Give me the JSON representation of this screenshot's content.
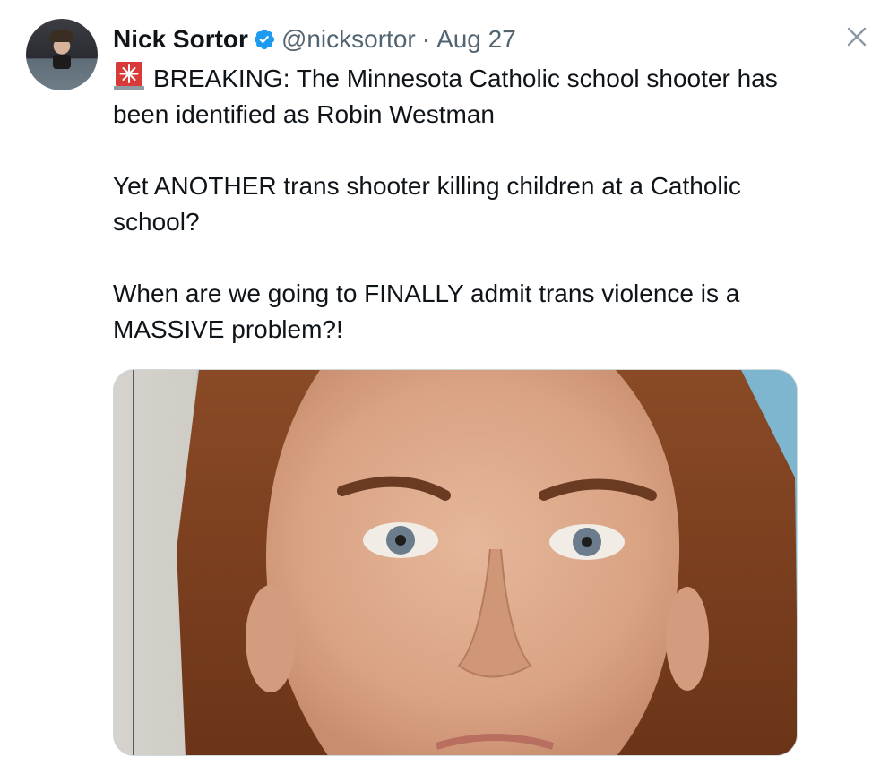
{
  "tweet": {
    "author": {
      "display_name": "Nick Sortor",
      "handle": "@nicksortor",
      "verified": true
    },
    "separator": "·",
    "date": "Aug 27",
    "text": {
      "paragraph_1": "BREAKING: The Minnesota Catholic school shooter has been identified as Robin Westman",
      "paragraph_2": "Yet ANOTHER trans shooter killing children at a Catholic school?",
      "paragraph_3": "When are we going to FINALLY admit trans violence is a MASSIVE problem?!"
    },
    "emoji": "police-car-light",
    "media": {
      "kind": "photo"
    }
  },
  "icons": {
    "close": "close-icon",
    "verified": "verified-badge-icon",
    "siren": "rotating-light-icon"
  },
  "colors": {
    "text": "#0f1419",
    "secondary_text": "#536471",
    "verified_blue": "#1d9bf0",
    "background": "#ffffff",
    "media_border": "#cfd9de"
  }
}
